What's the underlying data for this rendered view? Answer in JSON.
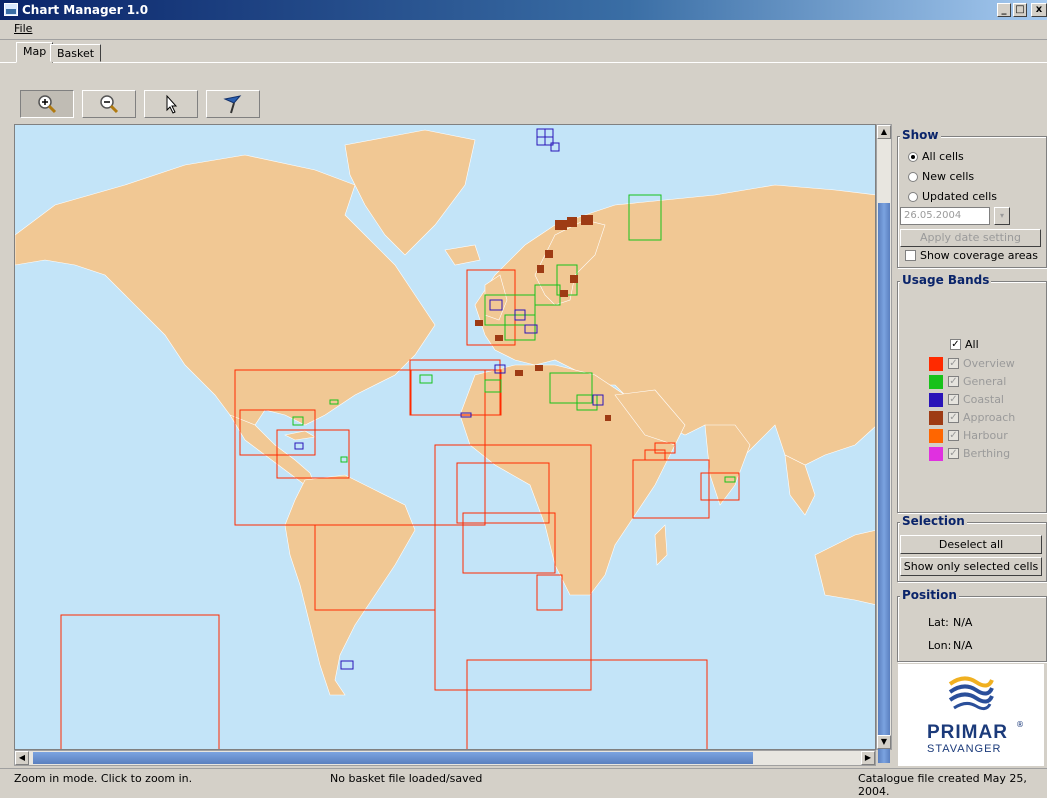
{
  "window": {
    "title": "Chart Manager 1.0",
    "min_glyph": "_",
    "max_glyph": "□",
    "close_glyph": "x"
  },
  "menu": {
    "file_label": "File"
  },
  "tabs": [
    {
      "label": "Map",
      "active": true
    },
    {
      "label": "Basket",
      "active": false
    }
  ],
  "toolbar": [
    {
      "icon": "zoom-in-icon",
      "pressed": true
    },
    {
      "icon": "zoom-out-icon",
      "pressed": false
    },
    {
      "icon": "pointer-icon",
      "pressed": false
    },
    {
      "icon": "pan-icon",
      "pressed": false
    }
  ],
  "show_panel": {
    "title": "Show",
    "options": [
      {
        "label": "All cells",
        "checked": true
      },
      {
        "label": "New cells",
        "checked": false
      },
      {
        "label": "Updated cells",
        "checked": false
      }
    ],
    "date_value": "26.05.2004",
    "apply_label": "Apply date setting",
    "coverage_label": "Show coverage areas"
  },
  "usage_bands": {
    "title": "Usage Bands",
    "all_label": "All",
    "bands": [
      {
        "label": "Overview",
        "color": "#ff2a00"
      },
      {
        "label": "General",
        "color": "#17c21a"
      },
      {
        "label": "Coastal",
        "color": "#2a14b8"
      },
      {
        "label": "Approach",
        "color": "#9e3b14"
      },
      {
        "label": "Harbour",
        "color": "#ff6600"
      },
      {
        "label": "Berthing",
        "color": "#e030e0"
      }
    ]
  },
  "selection": {
    "title": "Selection",
    "deselect_label": "Deselect all",
    "show_selected_label": "Show only selected cells"
  },
  "position": {
    "title": "Position",
    "lat_label": "Lat:",
    "lat_value": "N/A",
    "lon_label": "Lon:",
    "lon_value": "N/A"
  },
  "logo": {
    "line1": "PRIMAR",
    "line2": "STAVANGER",
    "reg": "®"
  },
  "status": {
    "mode": "Zoom in mode. Click to zoom in.",
    "basket": "No basket file loaded/saved",
    "catalogue": "Catalogue file created May 25, 2004."
  },
  "colors": {
    "sea": "#c3e4f8",
    "land": "#f1c894",
    "overview": "#ff2a00",
    "general": "#17c21a",
    "coastal": "#2a14b8",
    "approach": "#9e3b14"
  }
}
